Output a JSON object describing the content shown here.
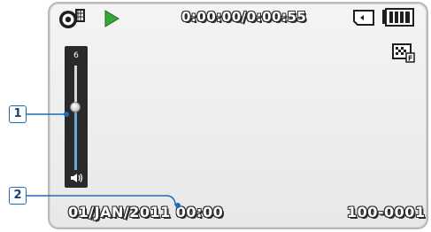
{
  "status_bar": {
    "timecode": "0:00:00/0:00:55",
    "mode_icon": "movie-playback-mode-icon",
    "play_icon": "play-icon",
    "storage_icon": "memory-card-icon",
    "battery_icon": "battery-full-icon",
    "quality_icon": "image-quality-icon"
  },
  "volume": {
    "level": "6",
    "fill_fraction": 0.6,
    "speaker_icon": "speaker-icon"
  },
  "footer": {
    "datetime": "01/JAN/2011 00:00",
    "file_number": "100-0001"
  },
  "callouts": {
    "one": "1",
    "two": "2"
  },
  "colors": {
    "callout": "#1b6db5",
    "play": "#3aa63a",
    "volume_fill": "#6aa6d8",
    "screen": "#eeeeee"
  }
}
